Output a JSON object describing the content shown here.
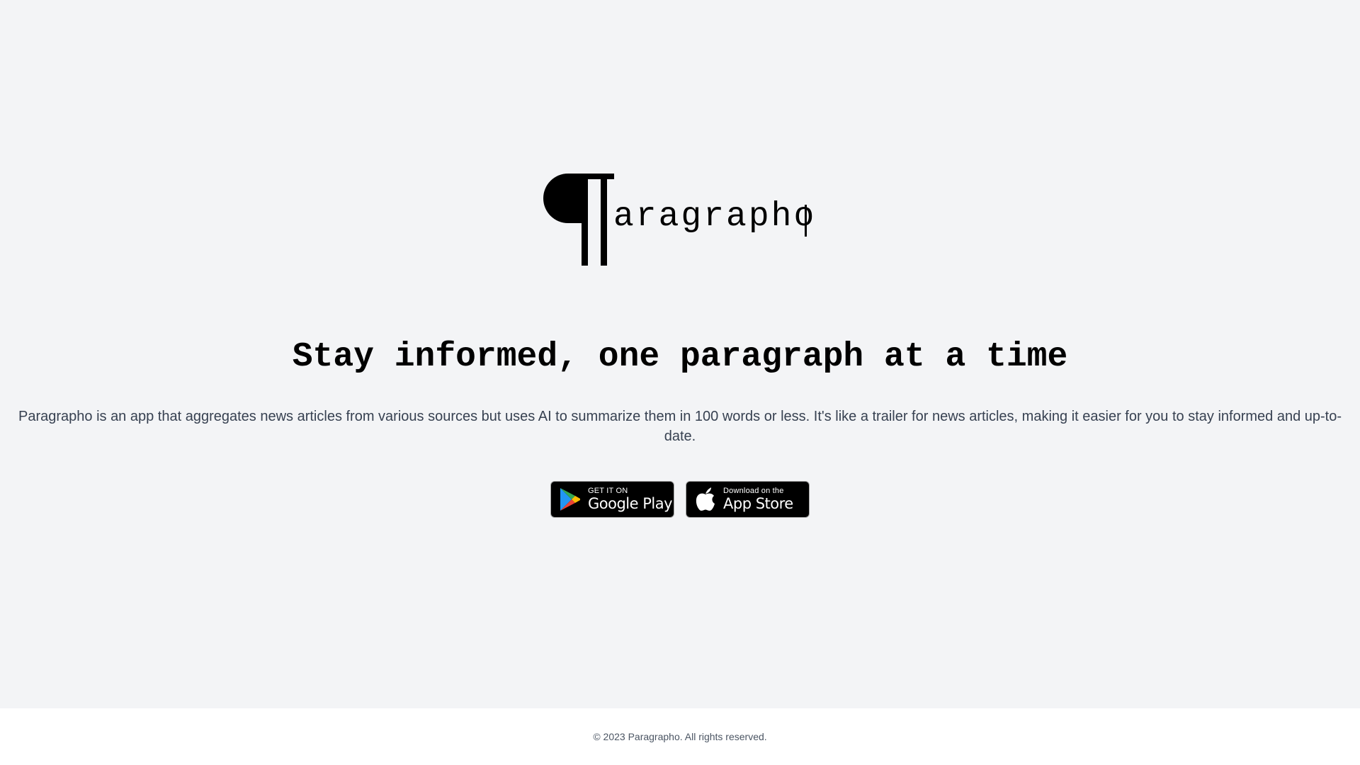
{
  "brand": {
    "logo_glyph": "¶",
    "wordmark": "aragrapho",
    "logo_icon": "pilcrow-icon"
  },
  "hero": {
    "headline": "Stay informed, one paragraph at a time",
    "description": "Paragrapho is an app that aggregates news articles from various sources but uses AI to summarize them in 100 words or less. It's like a trailer for news articles, making it easier for you to stay informed and up-to-date."
  },
  "badges": {
    "google_play": {
      "small": "GET IT ON",
      "large": "Google Play",
      "icon": "google-play-icon"
    },
    "app_store": {
      "small": "Download on the",
      "large": "App Store",
      "icon": "apple-icon"
    }
  },
  "footer": {
    "copyright": "© 2023 Paragrapho. All rights reserved."
  },
  "colors": {
    "background": "#f3f4f6",
    "footer_background": "#ffffff",
    "text_primary": "#000000",
    "text_body": "#374151",
    "text_footer": "#4b5563",
    "badge_background": "#000000"
  }
}
